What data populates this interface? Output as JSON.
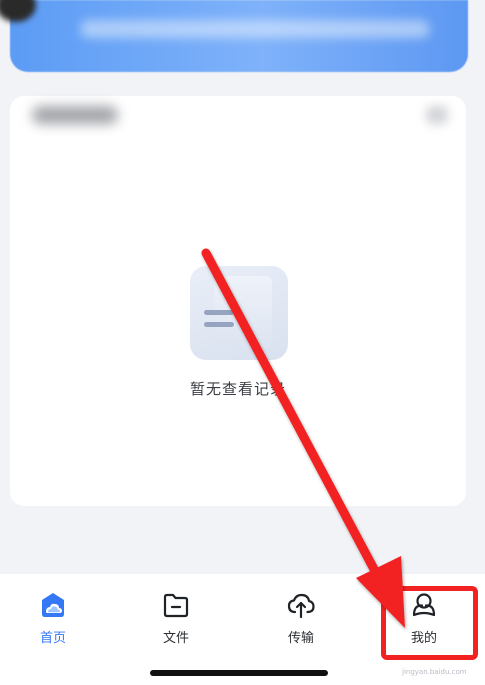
{
  "empty_state": {
    "text": "暂无查看记录"
  },
  "tabs": [
    {
      "label": "首页",
      "icon": "home-cloud-icon",
      "active": true
    },
    {
      "label": "文件",
      "icon": "folder-icon",
      "active": false
    },
    {
      "label": "传输",
      "icon": "upload-cloud-icon",
      "active": false
    },
    {
      "label": "我的",
      "icon": "profile-icon",
      "active": false
    }
  ],
  "colors": {
    "accent": "#3478f6",
    "annotation_red": "#f22222",
    "background": "#f2f3f6"
  },
  "watermark": "jingyan.baidu.com"
}
